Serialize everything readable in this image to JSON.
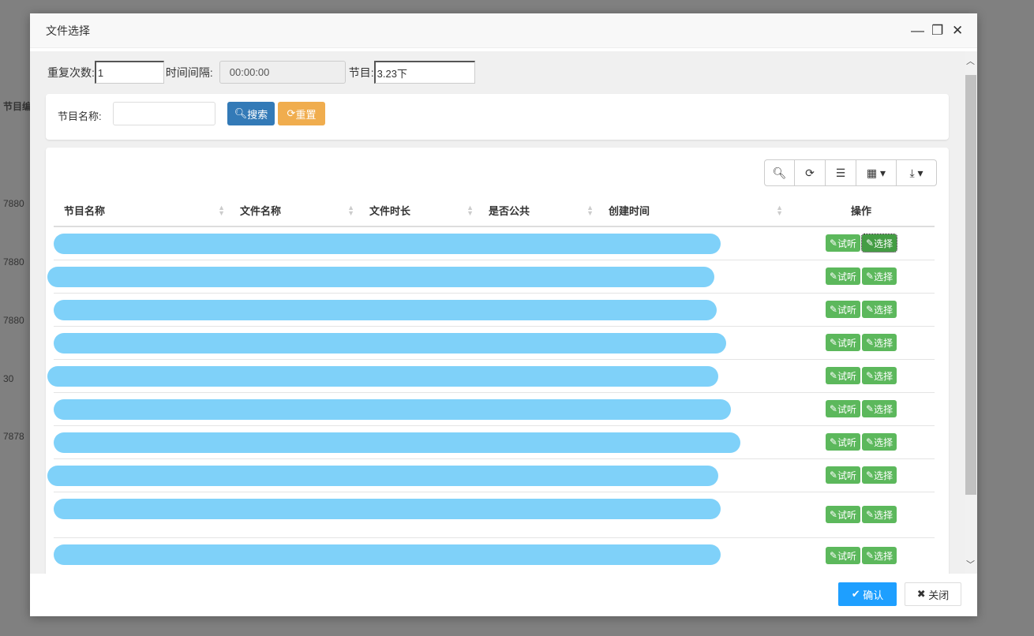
{
  "background": {
    "column_header": "节目编",
    "values": [
      "7880",
      "7880",
      "7880",
      "30",
      "7878"
    ]
  },
  "modal": {
    "title": "文件选择",
    "minimize": "—",
    "maximize": "❐",
    "close": "✕"
  },
  "form": {
    "repeat_label": "重复次数:",
    "repeat_value": "1",
    "interval_label": "时间间隔:",
    "interval_value": "00:00:00",
    "program_label": "节目:",
    "program_value": "3.23下"
  },
  "search": {
    "name_label": "节目名称:",
    "name_value": "",
    "search_btn": "搜索",
    "reset_btn": "重置"
  },
  "table": {
    "columns": [
      "节目名称",
      "文件名称",
      "文件时长",
      "是否公共",
      "创建时间",
      "操作"
    ],
    "row_actions": {
      "listen": "试听",
      "select": "选择"
    },
    "row_count": 10
  },
  "footer": {
    "confirm": "确认",
    "close": "关闭"
  },
  "colors": {
    "primary": "#337ab7",
    "warning": "#f0ad4e",
    "success": "#5cb85c",
    "confirm": "#1e9fff"
  }
}
